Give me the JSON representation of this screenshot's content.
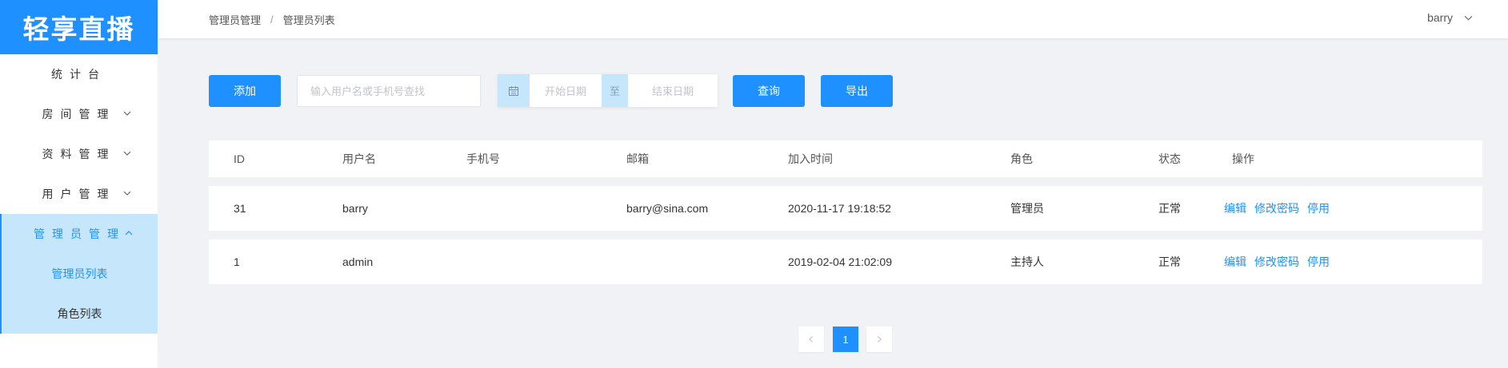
{
  "app": {
    "logo": "轻享直播"
  },
  "sidebar": {
    "items": [
      {
        "label": "统计台",
        "has_chevron": false
      },
      {
        "label": "房间管理",
        "has_chevron": true
      },
      {
        "label": "资料管理",
        "has_chevron": true
      },
      {
        "label": "用户管理",
        "has_chevron": true
      },
      {
        "label": "管理员管理",
        "has_chevron": true,
        "open": true
      }
    ],
    "submenu": [
      {
        "label": "管理员列表",
        "active": true
      },
      {
        "label": "角色列表",
        "active": false
      }
    ]
  },
  "header": {
    "breadcrumb": [
      "管理员管理",
      "管理员列表"
    ],
    "breadcrumb_sep": "/",
    "user": "barry"
  },
  "toolbar": {
    "add_label": "添加",
    "search_placeholder": "输入用户名或手机号查找",
    "start_placeholder": "开始日期",
    "to_label": "至",
    "end_placeholder": "结束日期",
    "query_label": "查询",
    "export_label": "导出"
  },
  "table": {
    "headers": [
      "ID",
      "用户名",
      "手机号",
      "邮箱",
      "加入时间",
      "角色",
      "状态",
      "操作"
    ],
    "rows": [
      {
        "id": "31",
        "username": "barry",
        "phone": "",
        "email": "barry@sina.com",
        "joined": "2020-11-17 19:18:52",
        "role": "管理员",
        "status": "正常"
      },
      {
        "id": "1",
        "username": "admin",
        "phone": "",
        "email": "",
        "joined": "2019-02-04 21:02:09",
        "role": "主持人",
        "status": "正常"
      }
    ],
    "actions": {
      "edit": "编辑",
      "change_password": "修改密码",
      "disable": "停用"
    }
  },
  "pagination": {
    "current": "1"
  },
  "colors": {
    "primary": "#1e90ff",
    "active_bg": "#c6e7fb",
    "page_bg": "#f1f2f6"
  }
}
